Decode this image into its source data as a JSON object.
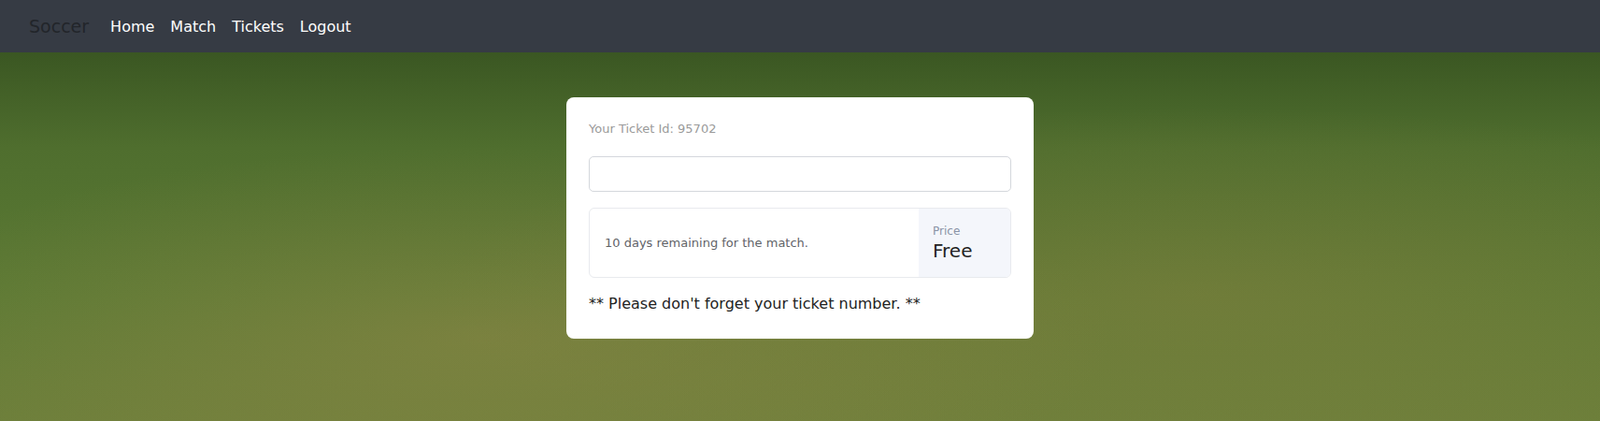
{
  "navbar": {
    "brand": "Soccer",
    "links": [
      {
        "label": "Home",
        "selected": false
      },
      {
        "label": "Match",
        "selected": false
      },
      {
        "label": "Tickets",
        "selected": false
      },
      {
        "label": "Logout",
        "selected": false
      }
    ]
  },
  "ticket": {
    "id_label": "Your Ticket Id: 95702",
    "field": {
      "value": ""
    },
    "remaining": "10 days remaining for the match.",
    "price_label": "Price",
    "price_value": "Free",
    "note": "** Please don't forget your ticket number. **"
  }
}
